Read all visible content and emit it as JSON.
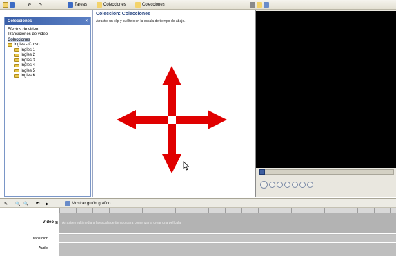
{
  "toolbar": {
    "tasks_label": "Tareas",
    "collections_label": "Colecciones",
    "collections_dropdown": "Colecciones"
  },
  "left_panel": {
    "header": "Colecciones",
    "items": [
      {
        "label": "Efectos de video"
      },
      {
        "label": "Transiciones de video"
      },
      {
        "label": "Colecciones"
      },
      {
        "label": "Ingles - Curso"
      },
      {
        "label": "Ingles 1"
      },
      {
        "label": "Ingles 2"
      },
      {
        "label": "Ingles 3"
      },
      {
        "label": "Ingles 4"
      },
      {
        "label": "Ingles 5"
      },
      {
        "label": "Ingles 6"
      }
    ]
  },
  "center": {
    "title": "Colección: Colecciones",
    "subtitle": "Arrastre un clip y suéltelo en la escala de tiempo de abajo."
  },
  "timeline": {
    "show_storyboard": "Mostrar guión gráfico",
    "video_label": "Video",
    "transition_label": "Transición",
    "audio_label": "Audio",
    "drop_hint": "Arrastre multimedia a la escala de tiempo para comenzar a crear una película."
  },
  "colors": {
    "arrow": "#e00000",
    "panel_header": "#3a5fa8",
    "preview_screen": "#000000"
  }
}
